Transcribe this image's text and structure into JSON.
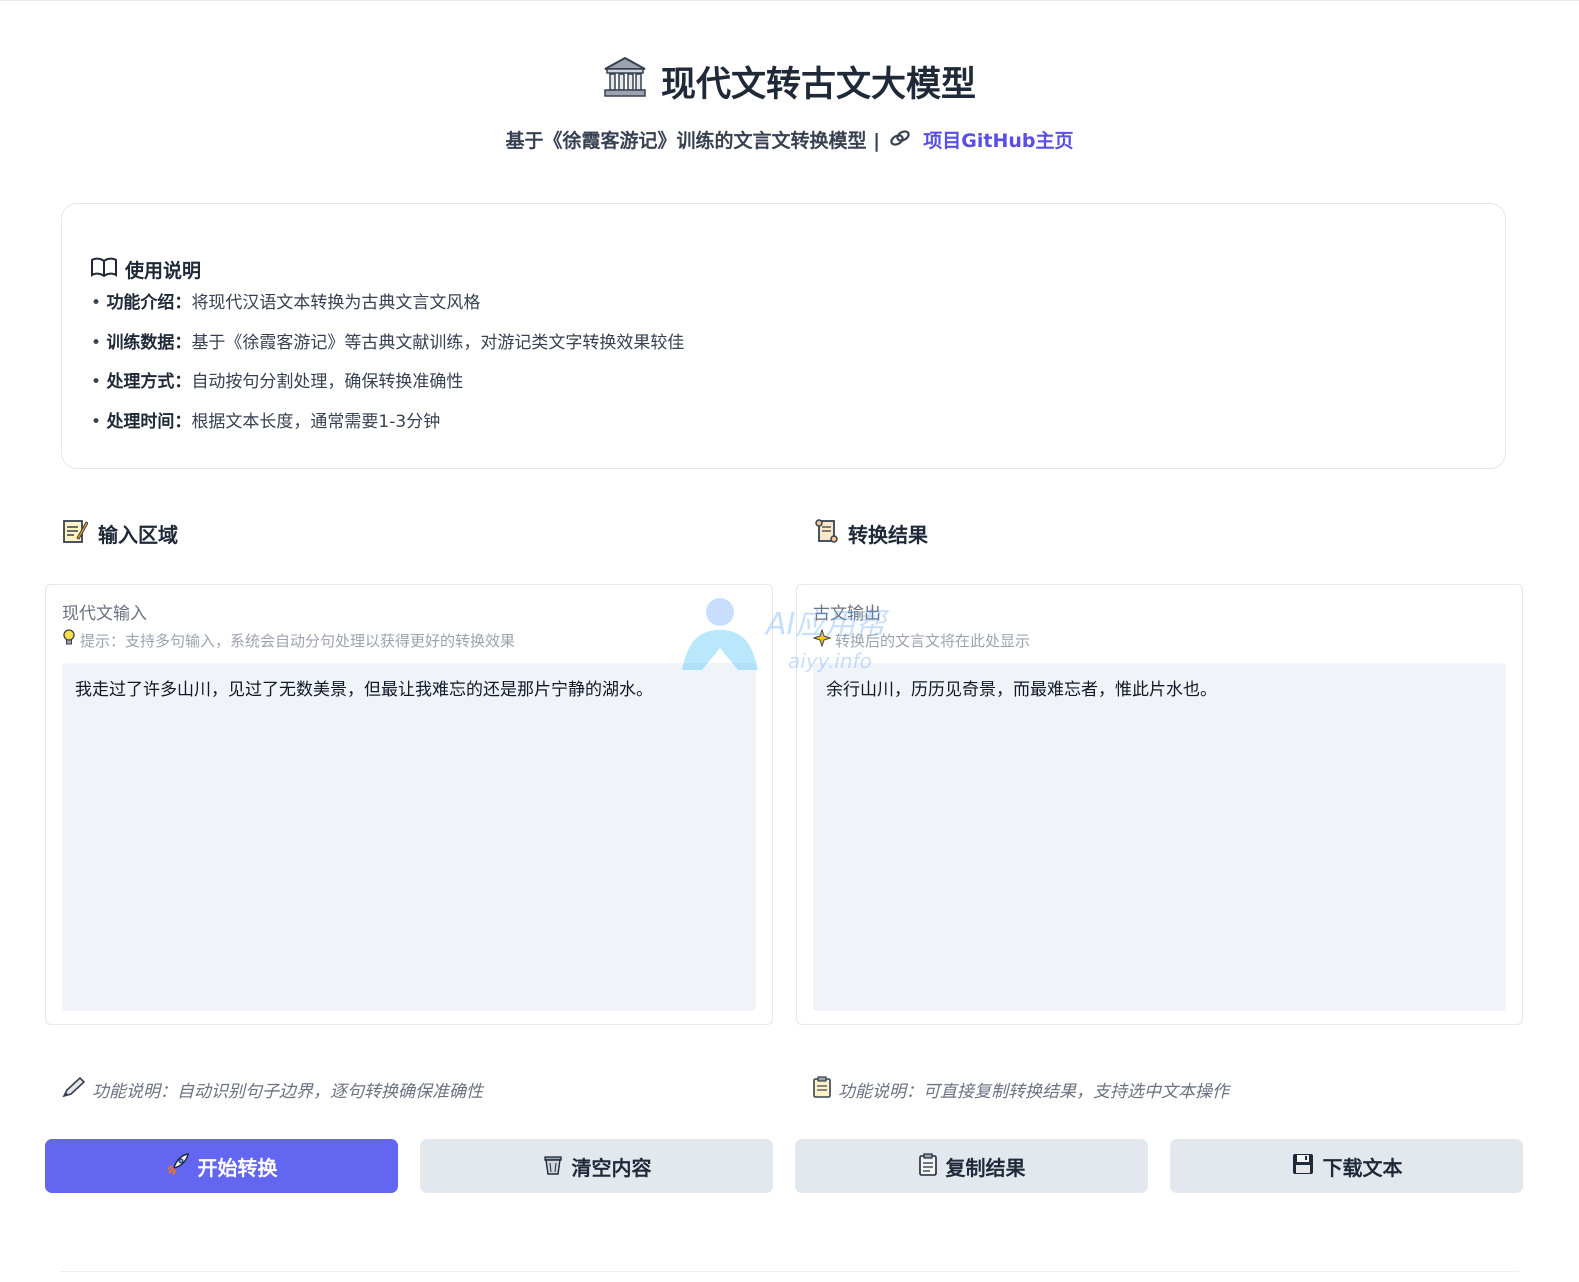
{
  "header": {
    "title": "现代文转古文大模型",
    "subtitle_text": "基于《徐霞客游记》训练的文言文转换模型 |",
    "github_link": "项目GitHub主页"
  },
  "instructions": {
    "heading": "使用说明",
    "items": [
      {
        "label": "功能介绍：",
        "text": "将现代汉语文本转换为古典文言文风格"
      },
      {
        "label": "训练数据：",
        "text": "基于《徐霞客游记》等古典文献训练，对游记类文字转换效果较佳"
      },
      {
        "label": "处理方式：",
        "text": "自动按句分割处理，确保转换准确性"
      },
      {
        "label": "处理时间：",
        "text": "根据文本长度，通常需要1-3分钟"
      }
    ]
  },
  "input": {
    "section_title": "输入区域",
    "label": "现代文输入",
    "hint": "提示：支持多句输入，系统会自动分句处理以获得更好的转换效果",
    "value": "我走过了许多山川，见过了无数美景，但最让我难忘的还是那片宁静的湖水。",
    "feature_note": "功能说明：自动识别句子边界，逐句转换确保准确性"
  },
  "output": {
    "section_title": "转换结果",
    "label": "古文输出",
    "hint": "转换后的文言文将在此处显示",
    "value": "余行山川，历历见奇景，而最难忘者，惟此片水也。",
    "feature_note": "功能说明：可直接复制转换结果，支持选中文本操作"
  },
  "buttons": {
    "convert": "开始转换",
    "clear": "清空内容",
    "copy": "复制结果",
    "download": "下载文本"
  },
  "watermark": {
    "line1": "AI应用帮",
    "line2": "aiyy.info"
  },
  "colors": {
    "accent": "#6366f1",
    "link": "#5b4ee6",
    "box_bg": "#f0f3f7",
    "secondary_btn": "#e3e8ef"
  },
  "icons": {
    "title": "classical-building-icon",
    "link": "link-icon",
    "instructions": "open-book-icon",
    "input": "memo-icon",
    "output": "scroll-icon",
    "hint_input": "lightbulb-icon",
    "hint_output": "sparkle-icon",
    "note_input": "pen-icon",
    "note_output": "clipboard-icon",
    "convert": "rocket-icon",
    "clear": "wastebasket-icon",
    "copy": "clipboard-icon",
    "download": "floppy-disk-icon"
  }
}
